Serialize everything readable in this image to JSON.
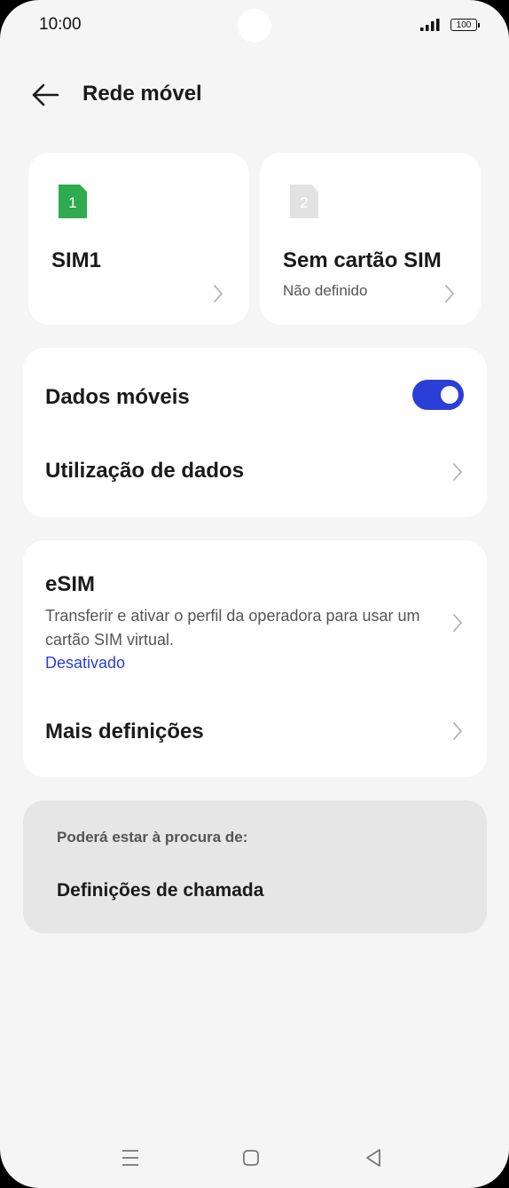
{
  "status_bar": {
    "time": "10:00",
    "battery": "100"
  },
  "header": {
    "title": "Rede móvel"
  },
  "sims": [
    {
      "badge": "1",
      "name": "SIM1",
      "subtitle": "",
      "badge_color": "#2faa4e"
    },
    {
      "badge": "2",
      "name": "Sem cartão SIM",
      "subtitle": "Não definido",
      "badge_color": "#e2e2e2"
    }
  ],
  "data_card": {
    "mobile_data_label": "Dados móveis",
    "mobile_data_on": true,
    "data_usage_label": "Utilização de dados"
  },
  "esim_card": {
    "title": "eSIM",
    "description": "Transferir e ativar o perfil da operadora para usar um cartão SIM virtual.",
    "status": "Desativado",
    "more_settings_label": "Mais definições"
  },
  "suggestions": {
    "label": "Poderá estar à procura de:",
    "item": "Definições de chamada"
  },
  "colors": {
    "accent": "#2a3fd6",
    "sim1": "#2faa4e",
    "background": "#f5f5f5"
  }
}
